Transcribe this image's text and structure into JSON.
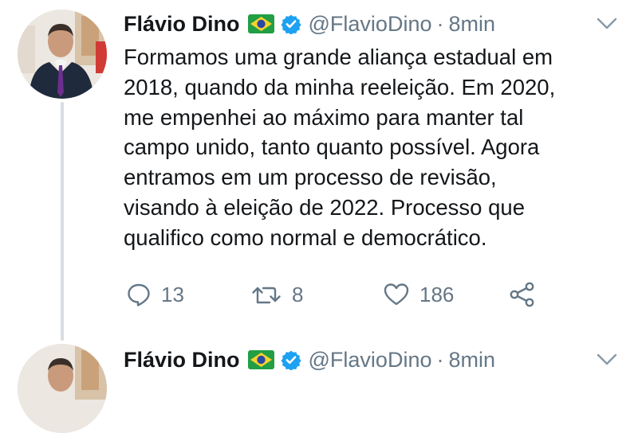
{
  "tweets": [
    {
      "author_name": "Flávio Dino",
      "handle": "@FlavioDino",
      "separator": "·",
      "time": "8min",
      "text": "Formamos uma grande aliança estadual em\n2018, quando da minha reeleição. Em 2020,\nme empenhei ao máximo para manter tal\ncampo unido, tanto quanto possível. Agora\nentramos em um processo de revisão,\nvisando à eleição de 2022. Processo que\nqualifico como normal e democrático.",
      "reply_count": "13",
      "retweet_count": "8",
      "like_count": "186"
    },
    {
      "author_name": "Flávio Dino",
      "handle": "@FlavioDino",
      "separator": "·",
      "time": "8min"
    }
  ],
  "icons": {
    "flag": "brazil-flag-icon",
    "verified": "verified-badge-icon",
    "caret": "chevron-down-icon",
    "reply": "reply-icon",
    "retweet": "retweet-icon",
    "like": "heart-icon",
    "share": "share-icon"
  },
  "colors": {
    "text": "#14171a",
    "secondary": "#657786",
    "verified": "#1da1f2",
    "thread_line": "#d7dde2"
  }
}
